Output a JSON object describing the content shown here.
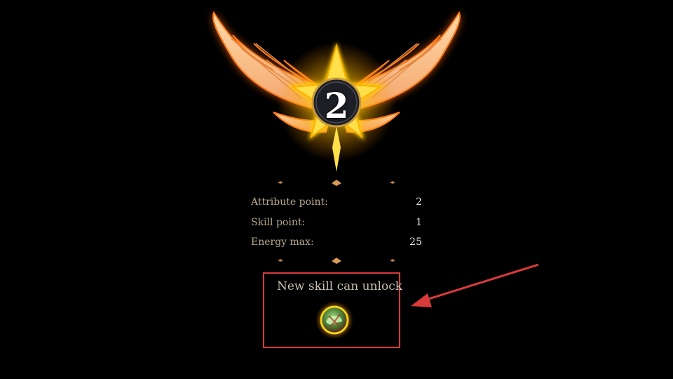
{
  "level_badge": {
    "level": "2"
  },
  "stats": {
    "rows": [
      {
        "label": "Attribute point:",
        "value": "2"
      },
      {
        "label": "Skill point:",
        "value": "1"
      },
      {
        "label": "Energy max:",
        "value": "25"
      }
    ]
  },
  "unlock": {
    "title": "New skill can unlock",
    "skill_icon": "green-dragon-skill-icon"
  },
  "colors": {
    "background": "#000000",
    "label_text": "#b9a98d",
    "value_text": "#e9e3d8",
    "highlight_border": "#d93a3a",
    "glow": "#ffb400"
  }
}
